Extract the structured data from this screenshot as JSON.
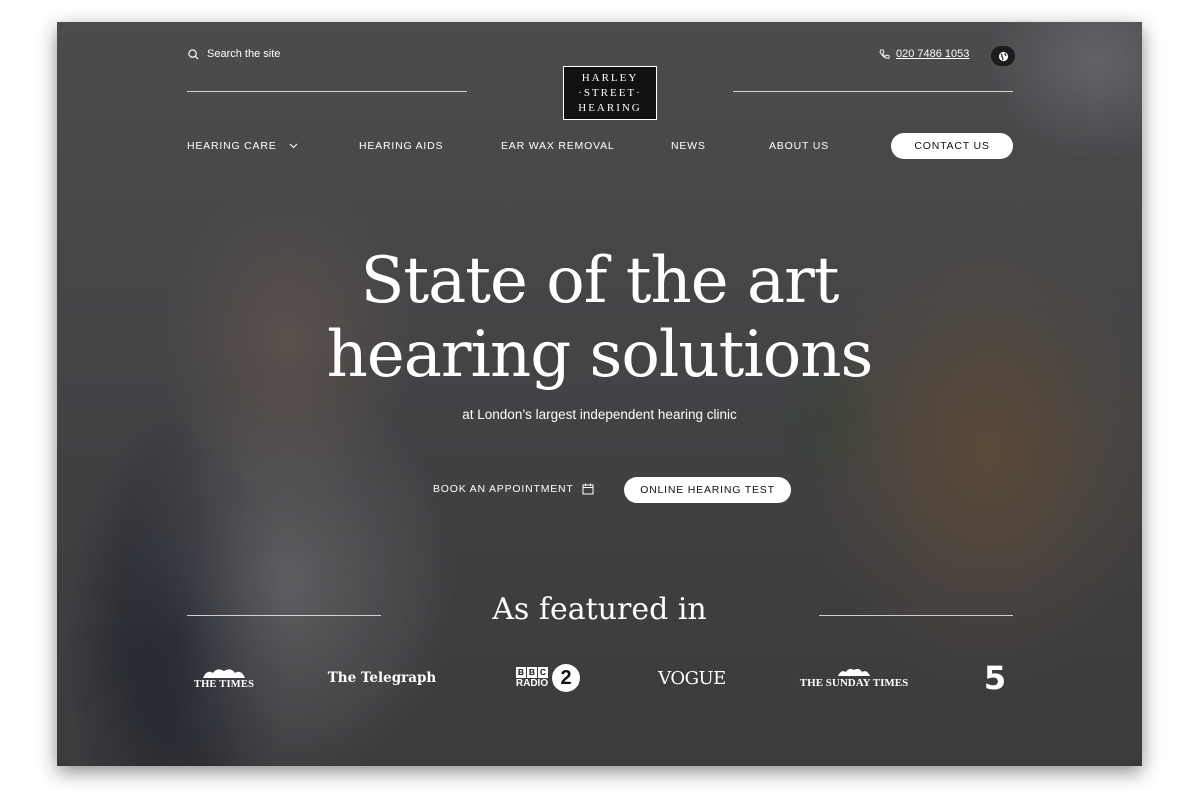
{
  "header": {
    "search_placeholder": "Search the site",
    "logo_lines": [
      "HARLEY",
      "·STREET·",
      "HEARING"
    ],
    "phone": "020 7486 1053"
  },
  "nav": {
    "items": [
      {
        "label": "HEARING CARE",
        "has_dropdown": true
      },
      {
        "label": "HEARING AIDS"
      },
      {
        "label": "EAR WAX REMOVAL"
      },
      {
        "label": "NEWS"
      },
      {
        "label": "ABOUT US"
      }
    ],
    "contact_label": "CONTACT US"
  },
  "hero": {
    "title_line1": "State of the art",
    "title_line2": "hearing solutions",
    "subtitle": "at London’s largest independent hearing clinic",
    "book_label": "BOOK AN APPOINTMENT",
    "test_label": "ONLINE HEARING TEST"
  },
  "featured": {
    "heading": "As featured in",
    "logos": [
      {
        "name": "the-times",
        "text": "THE TIMES"
      },
      {
        "name": "the-telegraph",
        "text": "The Telegraph"
      },
      {
        "name": "bbc-radio-2",
        "text": "BBC RADIO 2"
      },
      {
        "name": "vogue",
        "text": "VOGUE"
      },
      {
        "name": "the-sunday-times",
        "text": "THE SUNDAY TIMES"
      },
      {
        "name": "channel-5",
        "text": "5"
      }
    ]
  },
  "colors": {
    "overlay": "#1c1c1e",
    "text": "#ffffff",
    "button_bg": "#ffffff",
    "button_text": "#111111"
  }
}
